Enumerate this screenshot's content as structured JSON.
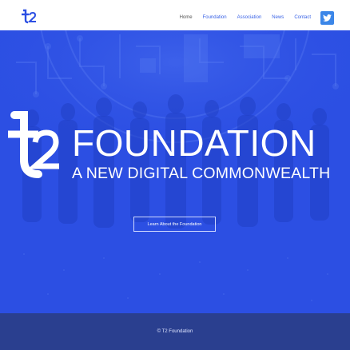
{
  "header": {
    "nav": [
      "Home",
      "Foundation",
      "Association",
      "News",
      "Contact"
    ],
    "social": "twitter-icon"
  },
  "hero": {
    "title": "FOUNDATION",
    "subtitle": "A NEW DIGITAL COMMONWEALTH",
    "cta_label": "Learn About the Foundation"
  },
  "footer": {
    "copyright": "© T2 Foundation"
  },
  "colors": {
    "hero_bg": "#2c4fe3",
    "footer_bg": "#2a3f8f",
    "nav_link": "#3a63e6",
    "twitter": "#3b86e8"
  }
}
